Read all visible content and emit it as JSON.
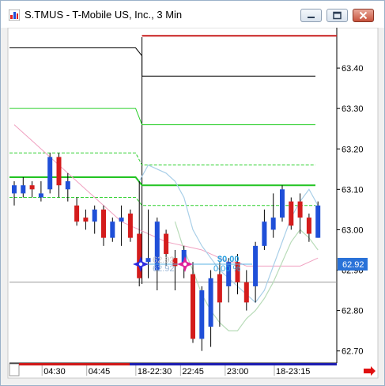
{
  "window": {
    "title": "S.TMUS - T-Mobile US, Inc., 3 Min",
    "minimize_icon": "minimize-icon",
    "maximize_icon": "maximize-icon",
    "close_icon": "close-icon"
  },
  "chart_data": {
    "type": "candlestick",
    "y_ticks": [
      "63.40",
      "63.30",
      "63.20",
      "63.10",
      "63.00",
      "62.90",
      "62.80",
      "62.70"
    ],
    "y_tick_values": [
      63.4,
      63.3,
      63.2,
      63.1,
      63.0,
      62.9,
      62.8,
      62.7
    ],
    "ylim": [
      62.67,
      63.5
    ],
    "x_labels": [
      "04:30",
      "04:45",
      "18-22:30",
      "22:45",
      "23:00",
      "18-23:15"
    ],
    "x_label_index": [
      4,
      9,
      14.5,
      19.5,
      24.5,
      30
    ],
    "current_price": "62.92",
    "current_price_value": 62.92,
    "order_marker": {
      "price_faint": "62.92",
      "price_faint2": "62.92",
      "pnl": "$0.00",
      "pnl_pct": "0.00 %"
    },
    "candles": [
      {
        "o": 63.09,
        "c": 63.11,
        "h": 63.12,
        "l": 63.06
      },
      {
        "o": 63.09,
        "c": 63.11,
        "h": 63.13,
        "l": 63.08
      },
      {
        "o": 63.11,
        "c": 63.1,
        "h": 63.12,
        "l": 63.08
      },
      {
        "o": 63.08,
        "c": 63.09,
        "h": 63.12,
        "l": 63.07
      },
      {
        "o": 63.1,
        "c": 63.18,
        "h": 63.19,
        "l": 63.09
      },
      {
        "o": 63.18,
        "c": 63.11,
        "h": 63.19,
        "l": 63.08
      },
      {
        "o": 63.1,
        "c": 63.12,
        "h": 63.14,
        "l": 63.07
      },
      {
        "o": 63.06,
        "c": 63.02,
        "h": 63.08,
        "l": 63.01
      },
      {
        "o": 63.03,
        "c": 63.02,
        "h": 63.05,
        "l": 63.0
      },
      {
        "o": 63.02,
        "c": 63.05,
        "h": 63.06,
        "l": 62.99
      },
      {
        "o": 63.05,
        "c": 62.98,
        "h": 63.06,
        "l": 62.96
      },
      {
        "o": 62.98,
        "c": 63.02,
        "h": 63.03,
        "l": 62.97
      },
      {
        "o": 63.02,
        "c": 63.03,
        "h": 63.06,
        "l": 62.96
      },
      {
        "o": 63.04,
        "c": 62.98,
        "h": 63.05,
        "l": 62.97
      },
      {
        "o": 62.99,
        "c": 62.88,
        "h": 63.12,
        "l": 62.86
      },
      {
        "o": 62.92,
        "c": 62.93,
        "h": 63.05,
        "l": 62.88
      },
      {
        "o": 62.9,
        "c": 63.02,
        "h": 63.03,
        "l": 62.85
      },
      {
        "o": 62.99,
        "c": 62.94,
        "h": 63.0,
        "l": 62.91
      },
      {
        "o": 62.93,
        "c": 62.91,
        "h": 62.95,
        "l": 62.85
      },
      {
        "o": 62.91,
        "c": 62.95,
        "h": 62.96,
        "l": 62.88
      },
      {
        "o": 62.89,
        "c": 62.73,
        "h": 62.92,
        "l": 62.72
      },
      {
        "o": 62.73,
        "c": 62.85,
        "h": 62.86,
        "l": 62.7
      },
      {
        "o": 62.76,
        "c": 62.88,
        "h": 62.9,
        "l": 62.71
      },
      {
        "o": 62.89,
        "c": 62.82,
        "h": 62.92,
        "l": 62.76
      },
      {
        "o": 62.86,
        "c": 62.92,
        "h": 62.93,
        "l": 62.82
      },
      {
        "o": 62.92,
        "c": 62.87,
        "h": 62.94,
        "l": 62.84
      },
      {
        "o": 62.87,
        "c": 62.82,
        "h": 62.9,
        "l": 62.8
      },
      {
        "o": 62.86,
        "c": 62.96,
        "h": 62.97,
        "l": 62.82
      },
      {
        "o": 62.96,
        "c": 63.02,
        "h": 63.05,
        "l": 62.95
      },
      {
        "o": 63.0,
        "c": 63.03,
        "h": 63.09,
        "l": 62.98
      },
      {
        "o": 63.03,
        "c": 63.1,
        "h": 63.11,
        "l": 63.02
      },
      {
        "o": 63.07,
        "c": 63.01,
        "h": 63.08,
        "l": 63.0
      },
      {
        "o": 63.07,
        "c": 63.03,
        "h": 63.09,
        "l": 62.99
      },
      {
        "o": 63.03,
        "c": 62.99,
        "h": 63.04,
        "l": 62.97
      },
      {
        "o": 62.98,
        "c": 63.06,
        "h": 63.07,
        "l": 62.98
      }
    ],
    "bid_line": {
      "from_index": -1,
      "to_index": 34.5,
      "values_before": 63.45,
      "values_after": 63.38,
      "break_index": 14.3
    },
    "green_levels": [
      {
        "style": "solid",
        "value_before": 63.3,
        "value_after": 63.26,
        "width": 1
      },
      {
        "style": "dashed",
        "value_before": 63.19,
        "value_after": 63.16,
        "width": 1
      },
      {
        "style": "solid",
        "value_before": 63.13,
        "value_after": 63.11,
        "width": 2
      },
      {
        "style": "dashed",
        "value_before": 63.08,
        "value_after": 63.06,
        "width": 1
      }
    ],
    "ask_line_value": 63.48,
    "gray_hline_value": 62.87,
    "pink_ma": [
      63.26,
      63.24,
      63.22,
      63.2,
      63.18,
      63.16,
      63.14,
      63.12,
      63.1,
      63.08,
      63.06,
      63.04,
      63.02,
      63.01,
      63.0,
      62.99,
      62.98,
      62.97,
      62.965,
      62.96,
      62.955,
      62.95,
      62.94,
      62.93,
      62.92,
      62.92,
      62.91,
      62.91,
      62.91,
      62.91,
      62.91,
      62.91,
      62.91,
      62.92,
      62.93
    ],
    "lightblue_ma": [
      null,
      null,
      null,
      null,
      null,
      null,
      null,
      null,
      null,
      null,
      null,
      null,
      null,
      null,
      63.12,
      63.16,
      63.15,
      63.14,
      63.12,
      63.08,
      63.0,
      62.96,
      62.93,
      62.9,
      62.88,
      62.86,
      62.84,
      62.82,
      62.85,
      62.91,
      62.97,
      63.03,
      63.07,
      63.1,
      63.06
    ],
    "palegreen_ma": [
      null,
      null,
      null,
      null,
      null,
      null,
      null,
      null,
      null,
      null,
      null,
      null,
      null,
      null,
      null,
      null,
      null,
      null,
      63.02,
      62.95,
      62.9,
      62.84,
      62.8,
      62.77,
      62.75,
      62.75,
      62.78,
      62.8,
      62.83,
      62.87,
      62.92,
      62.97,
      63.0,
      62.98,
      62.95
    ]
  }
}
